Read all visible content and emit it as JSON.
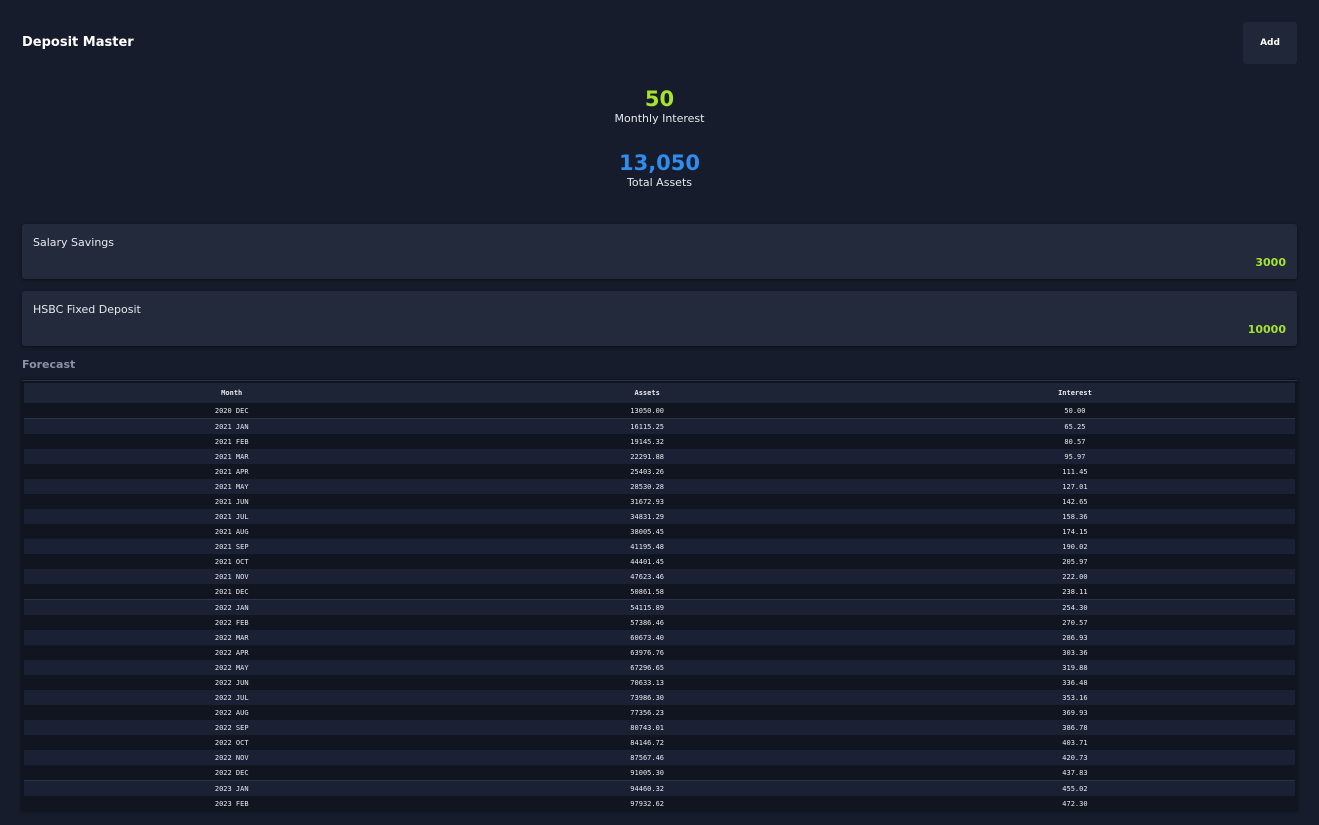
{
  "app": {
    "title": "Deposit Master",
    "add_label": "Add"
  },
  "stats": {
    "monthly_interest": {
      "value": "50",
      "label": "Monthly Interest"
    },
    "total_assets": {
      "value": "13,050",
      "label": "Total Assets"
    }
  },
  "accounts": [
    {
      "name": "Salary Savings",
      "amount": "3000"
    },
    {
      "name": "HSBC Fixed Deposit",
      "amount": "10000"
    }
  ],
  "forecast": {
    "label": "Forecast",
    "columns": [
      "Month",
      "Assets",
      "Interest"
    ],
    "rows": [
      [
        "2020 DEC",
        "13050.00",
        "50.00"
      ],
      [
        "2021 JAN",
        "16115.25",
        "65.25"
      ],
      [
        "2021 FEB",
        "19145.32",
        "80.57"
      ],
      [
        "2021 MAR",
        "22291.88",
        "95.97"
      ],
      [
        "2021 APR",
        "25403.26",
        "111.45"
      ],
      [
        "2021 MAY",
        "28530.28",
        "127.01"
      ],
      [
        "2021 JUN",
        "31672.93",
        "142.65"
      ],
      [
        "2021 JUL",
        "34831.29",
        "158.36"
      ],
      [
        "2021 AUG",
        "38005.45",
        "174.15"
      ],
      [
        "2021 SEP",
        "41195.48",
        "190.02"
      ],
      [
        "2021 OCT",
        "44401.45",
        "205.97"
      ],
      [
        "2021 NOV",
        "47623.46",
        "222.00"
      ],
      [
        "2021 DEC",
        "50861.58",
        "238.11"
      ],
      [
        "2022 JAN",
        "54115.89",
        "254.30"
      ],
      [
        "2022 FEB",
        "57386.46",
        "270.57"
      ],
      [
        "2022 MAR",
        "60673.40",
        "286.93"
      ],
      [
        "2022 APR",
        "63976.76",
        "303.36"
      ],
      [
        "2022 MAY",
        "67296.65",
        "319.88"
      ],
      [
        "2022 JUN",
        "70633.13",
        "336.48"
      ],
      [
        "2022 JUL",
        "73986.30",
        "353.16"
      ],
      [
        "2022 AUG",
        "77356.23",
        "369.93"
      ],
      [
        "2022 SEP",
        "80743.01",
        "386.78"
      ],
      [
        "2022 OCT",
        "84146.72",
        "403.71"
      ],
      [
        "2022 NOV",
        "87567.46",
        "420.73"
      ],
      [
        "2022 DEC",
        "91005.30",
        "437.83"
      ],
      [
        "2023 JAN",
        "94460.32",
        "455.02"
      ],
      [
        "2023 FEB",
        "97932.62",
        "472.30"
      ]
    ]
  }
}
